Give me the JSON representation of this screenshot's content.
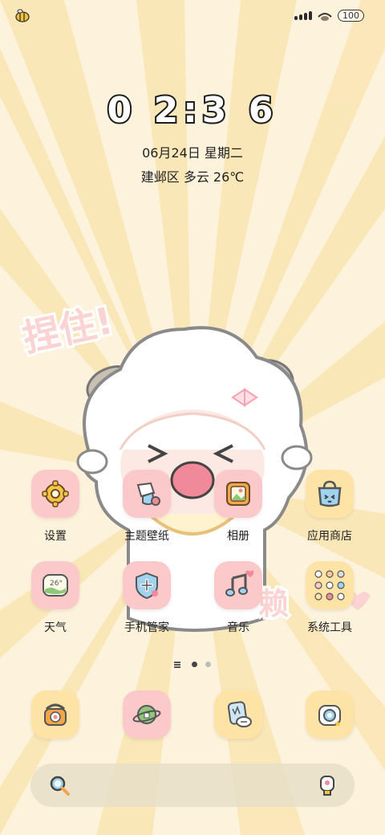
{
  "status_bar": {
    "battery": "100",
    "left_icon": "bee-icon"
  },
  "clock": {
    "time": "02:36",
    "date": "06月24日 星期二",
    "weather": "建邺区 多云 26℃"
  },
  "wallpaper": {
    "sticker_text_1": "捏住!",
    "sticker_text_2": "赖"
  },
  "apps": {
    "row1": [
      {
        "label": "设置",
        "icon": "gear-icon"
      },
      {
        "label": "主题壁纸",
        "icon": "paint-brush-icon"
      },
      {
        "label": "相册",
        "icon": "photo-frame-icon"
      },
      {
        "label": "应用商店",
        "icon": "shopping-bag-icon"
      }
    ],
    "row2": [
      {
        "label": "天气",
        "icon": "weather-thermometer-icon"
      },
      {
        "label": "手机管家",
        "icon": "shield-plus-icon"
      },
      {
        "label": "音乐",
        "icon": "music-note-icon"
      },
      {
        "label": "系统工具",
        "icon": "folder-grid-icon"
      }
    ]
  },
  "dock": [
    {
      "icon": "phone-icon"
    },
    {
      "icon": "planet-browser-icon"
    },
    {
      "icon": "messages-icon"
    },
    {
      "icon": "camera-icon"
    }
  ],
  "page_indicator": {
    "pages": 2,
    "current": 1
  },
  "search_bar": {
    "left_icon": "search-icon",
    "right_icon": "assistant-icon"
  },
  "colors": {
    "background": "#fdf3dc",
    "ray": "#fbe6b6",
    "pink_tile": "#fbc9c9",
    "yellow_tile": "#fde4a6"
  },
  "timestamp_text": "0 2:3 6"
}
